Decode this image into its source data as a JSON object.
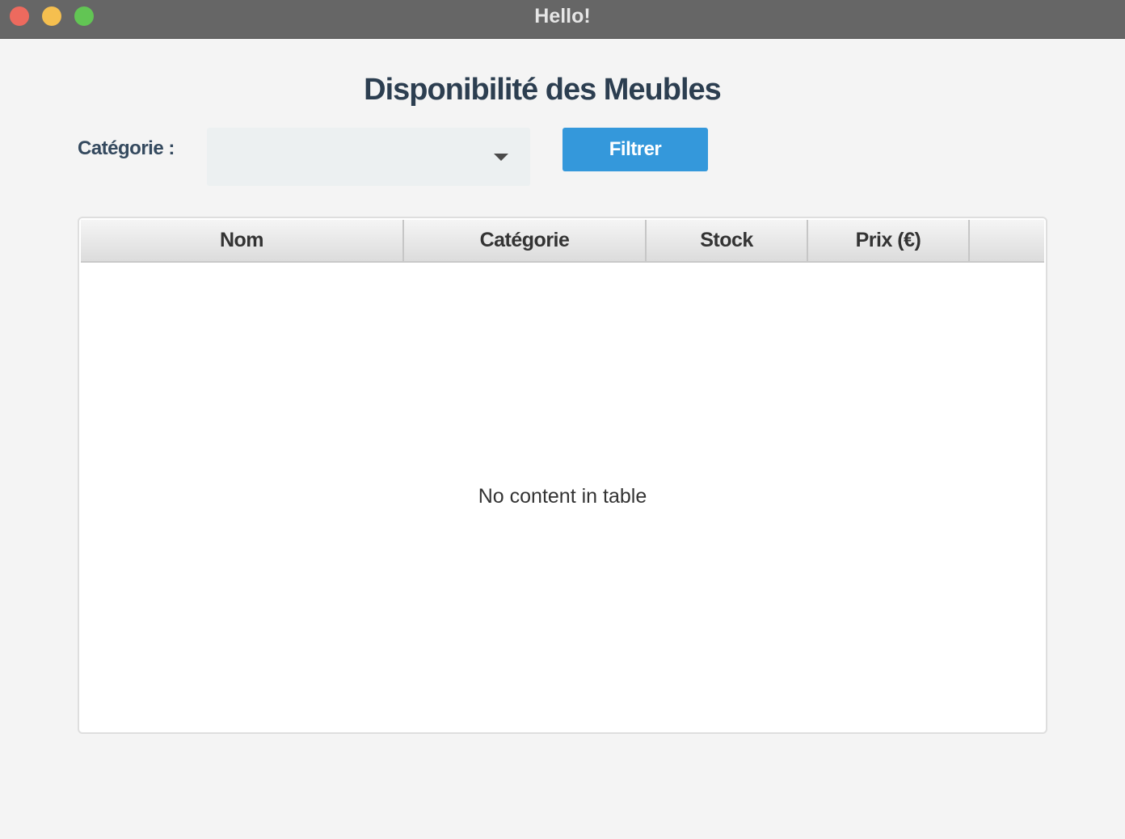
{
  "window": {
    "title": "Hello!"
  },
  "page": {
    "title": "Disponibilité des Meubles"
  },
  "filter": {
    "label": "Catégorie :",
    "selected_value": "",
    "button_label": "Filtrer"
  },
  "table": {
    "columns": [
      "Nom",
      "Catégorie",
      "Stock",
      "Prix (€)",
      ""
    ],
    "rows": [],
    "empty_message": "No content in table"
  },
  "colors": {
    "accent": "#3498db",
    "title_text": "#2c3e50",
    "label_text": "#34495e",
    "titlebar": "#666666",
    "close": "#ed6a5e",
    "minimize": "#f5bf4f",
    "zoom": "#62c554"
  },
  "icons": {
    "combo_arrow": "chevron-down-icon"
  }
}
